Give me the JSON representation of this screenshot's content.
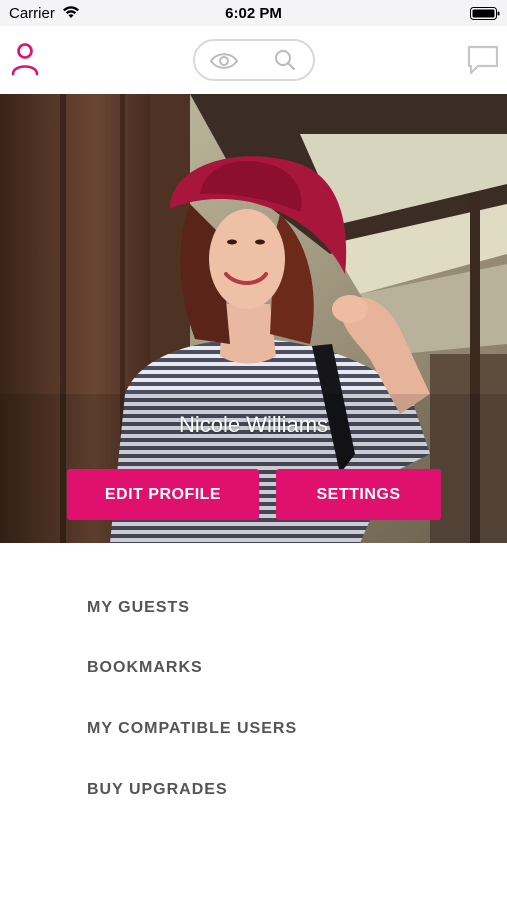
{
  "status_bar": {
    "carrier": "Carrier",
    "time": "6:02 PM"
  },
  "nav": {
    "profile_icon": "person-icon",
    "eye_icon": "eye-icon",
    "search_icon": "search-icon",
    "chat_icon": "chat-bubble-icon",
    "accent_color": "#e0116e"
  },
  "profile": {
    "name": "Nicole Williams",
    "edit_label": "EDIT PROFILE",
    "settings_label": "SETTINGS"
  },
  "menu": {
    "items": [
      "MY GUESTS",
      "BOOKMARKS",
      "MY COMPATIBLE USERS",
      "BUY UPGRADES"
    ]
  }
}
